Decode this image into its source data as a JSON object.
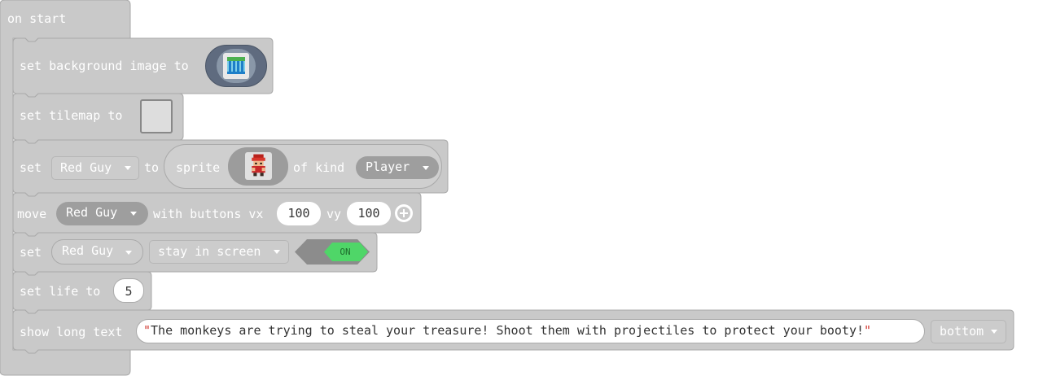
{
  "hat": {
    "label": "on start"
  },
  "blocks": {
    "set_background": {
      "label": "set background image to",
      "image_icon": "pillars-image-icon"
    },
    "set_tilemap": {
      "label": "set tilemap to"
    },
    "set_sprite": {
      "set_label": "set",
      "variable": "Red Guy",
      "to_label": "to",
      "sprite_label": "sprite",
      "sprite_icon": "red-guy-sprite-icon",
      "of_kind_label": "of kind",
      "kind": "Player"
    },
    "move": {
      "move_label": "move",
      "variable": "Red Guy",
      "with_buttons_label": "with buttons vx",
      "vx": "100",
      "vy_label": "vy",
      "vy": "100"
    },
    "stay_in_screen": {
      "set_label": "set",
      "variable": "Red Guy",
      "flag": "stay in screen",
      "toggle": "ON"
    },
    "set_life": {
      "label": "set life to",
      "value": "5"
    },
    "show_text": {
      "label": "show long text",
      "text": "The monkeys are trying to steal your treasure! Shoot them with projectiles to protect your booty!",
      "position": "bottom"
    }
  },
  "colors": {
    "block_fill": "#c9c9c9",
    "block_stroke": "#a9a9a9",
    "toggle_on": "#4fd668",
    "toggle_dark": "#8c8c8c"
  }
}
